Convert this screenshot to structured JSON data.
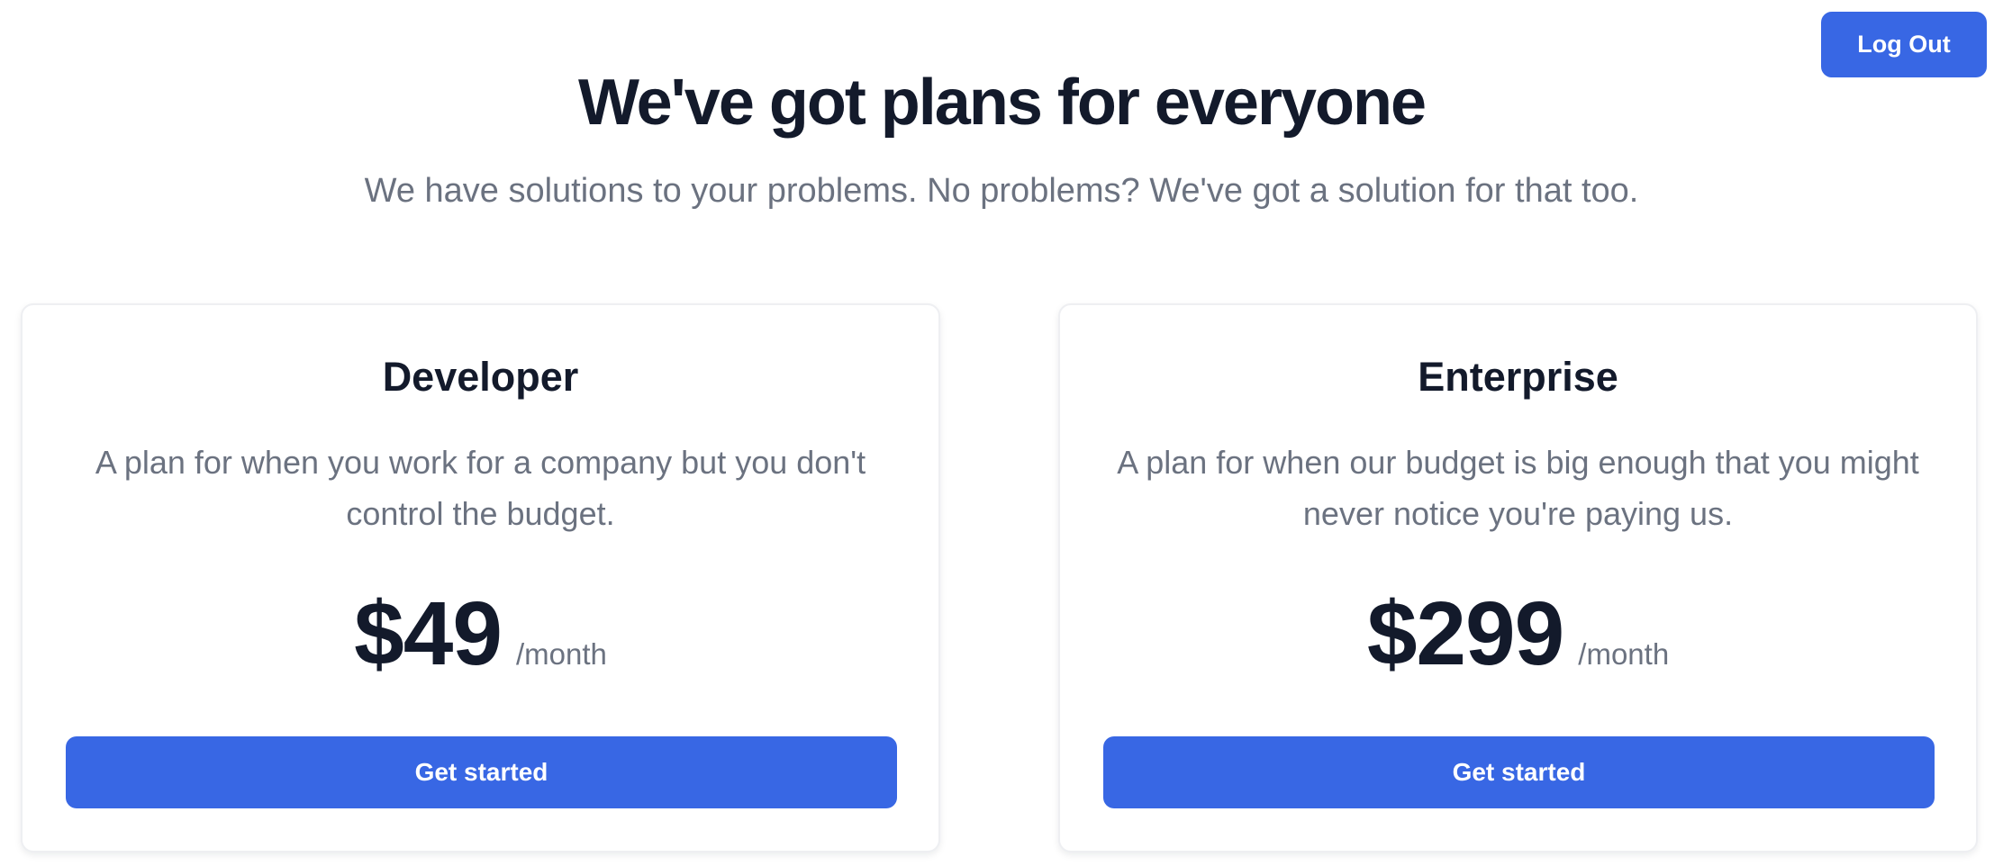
{
  "header": {
    "logout_label": "Log Out",
    "title": "We've got plans for everyone",
    "subtitle": "We have solutions to your problems. No problems? We've got a solution for that too."
  },
  "plans": [
    {
      "name": "Developer",
      "description": "A plan for when you work for a company but you don't control the budget.",
      "price": "$49",
      "period": "/month",
      "cta_label": "Get started"
    },
    {
      "name": "Enterprise",
      "description": "A plan for when our budget is big enough that you might never notice you're paying us.",
      "price": "$299",
      "period": "/month",
      "cta_label": "Get started"
    }
  ],
  "colors": {
    "accent": "#3867e4",
    "heading": "#131a2b",
    "muted": "#6b7280",
    "card_border": "#eeeff2"
  }
}
